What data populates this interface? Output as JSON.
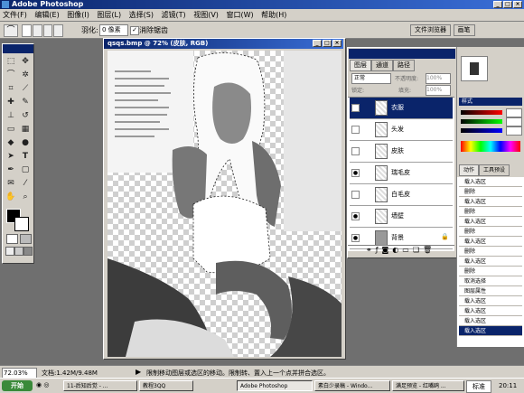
{
  "window": {
    "title": "Adobe Photoshop"
  },
  "menu": [
    "文件(F)",
    "编辑(E)",
    "图像(I)",
    "图层(L)",
    "选择(S)",
    "滤镜(T)",
    "视图(V)",
    "窗口(W)",
    "帮助(H)"
  ],
  "options": {
    "feather_label": "羽化:",
    "feather_value": "0 像素",
    "antialias_label": "消除锯齿"
  },
  "dock_tabs": [
    "文件浏览器",
    "画笔"
  ],
  "document": {
    "title": "qsqs.bmp @ 72% (皮肤, RGB)"
  },
  "layers_panel": {
    "tabs": [
      "图层",
      "通道",
      "路径"
    ],
    "blend_mode": "正常",
    "opacity_label": "不透明度:",
    "opacity": "100%",
    "lock_label": "锁定:",
    "fill_label": "填充:",
    "fill": "100%",
    "layers": [
      {
        "name": "衣服",
        "selected": true,
        "visible": false
      },
      {
        "name": "头发",
        "selected": false,
        "visible": false
      },
      {
        "name": "皮肤",
        "selected": false,
        "visible": false
      },
      {
        "name": "瑞毛皮",
        "selected": false,
        "visible": true
      },
      {
        "name": "白毛皮",
        "selected": false,
        "visible": false
      },
      {
        "name": "墙壁",
        "selected": false,
        "visible": true
      },
      {
        "name": "背景",
        "selected": false,
        "visible": true
      }
    ]
  },
  "styles_panel": {
    "title": "样式"
  },
  "history_panel": {
    "tabs": [
      "动作",
      "工具预设"
    ],
    "items": [
      "载入选区",
      "删除",
      "载入选区",
      "删除",
      "载入选区",
      "删除",
      "载入选区",
      "删除",
      "载入选区",
      "删除",
      "取消选择",
      "图层属性",
      "载入选区",
      "载入选区",
      "载入选区",
      "载入选区"
    ]
  },
  "status": {
    "zoom": "72.03%",
    "doc": "文档:1.42M/9.48M",
    "hint": "限制移动图层或选区的移动。限制转、置入上一个点并拼合选区。"
  },
  "taskbar": {
    "start": "开始",
    "tasks": [
      "11-后知后觉 - ...",
      "教程3QQ",
      "Adobe Photoshop",
      "素白少录稿 - Windo...",
      "满足预览 - 红嘴鸥 ..."
    ],
    "active_index": 2,
    "ime": "标准",
    "clock": "20:11"
  },
  "colors": {
    "selection": "#0a246a",
    "chrome": "#d4d0c8",
    "workspace": "#6f6f6f"
  }
}
